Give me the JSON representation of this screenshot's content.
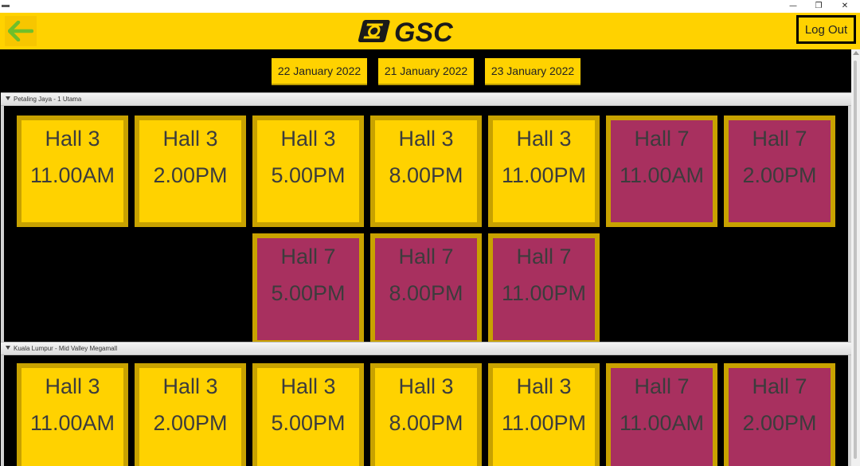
{
  "window": {
    "minimize_glyph": "—",
    "restore_glyph": "❐",
    "close_glyph": "✕"
  },
  "header": {
    "logo_text": "GSC",
    "logout_label": "Log Out",
    "accent_color": "#ffd200"
  },
  "dates": [
    "22 January 2022",
    "21 January 2022",
    "23 January 2022"
  ],
  "cinemas": [
    {
      "name": "Petaling Jaya - 1 Utama",
      "showtimes": [
        {
          "hall": "Hall 3",
          "time": "11.00AM"
        },
        {
          "hall": "Hall 3",
          "time": "2.00PM"
        },
        {
          "hall": "Hall 3",
          "time": "5.00PM"
        },
        {
          "hall": "Hall 3",
          "time": "8.00PM"
        },
        {
          "hall": "Hall 3",
          "time": "11.00PM"
        },
        {
          "hall": "Hall 7",
          "time": "11.00AM"
        },
        {
          "hall": "Hall 7",
          "time": "2.00PM"
        },
        {
          "hall": "Hall 7",
          "time": "5.00PM"
        },
        {
          "hall": "Hall 7",
          "time": "8.00PM"
        },
        {
          "hall": "Hall 7",
          "time": "11.00PM"
        }
      ]
    },
    {
      "name": "Kuala Lumpur - Mid Valley Megamall",
      "showtimes": [
        {
          "hall": "Hall 3",
          "time": "11.00AM"
        },
        {
          "hall": "Hall 3",
          "time": "2.00PM"
        },
        {
          "hall": "Hall 3",
          "time": "5.00PM"
        },
        {
          "hall": "Hall 3",
          "time": "8.00PM"
        },
        {
          "hall": "Hall 3",
          "time": "11.00PM"
        },
        {
          "hall": "Hall 7",
          "time": "11.00AM"
        },
        {
          "hall": "Hall 7",
          "time": "2.00PM"
        }
      ]
    }
  ],
  "colors": {
    "hall3": "#ffd200",
    "hall7": "#a8305f",
    "tile_border": "#c8a200"
  }
}
